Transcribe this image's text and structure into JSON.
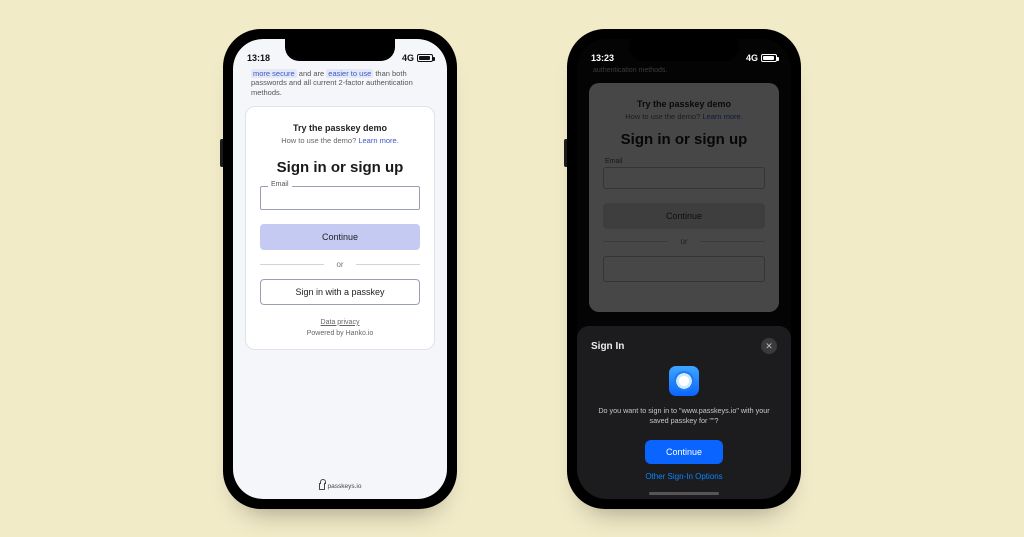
{
  "left": {
    "status": {
      "time": "13:18",
      "network": "4G"
    },
    "intro": {
      "hl1": "more secure",
      "mid1": " and are ",
      "hl2": "easier to use",
      "tail": " than both passwords and all current 2-factor authentication methods."
    },
    "card": {
      "try_title": "Try the passkey demo",
      "howto_prefix": "How to use the demo? ",
      "howto_link": "Learn more.",
      "headline": "Sign in or sign up",
      "email_label": "Email",
      "continue": "Continue",
      "or": "or",
      "passkey_btn": "Sign in with a passkey",
      "privacy": "Data privacy",
      "powered": "Powered by Hanko.io"
    },
    "footer_domain": "passkeys.io"
  },
  "right": {
    "status": {
      "time": "13:23",
      "network": "4G"
    },
    "auth_line": "authentication methods.",
    "bg": {
      "try_title": "Try the passkey demo",
      "howto_prefix": "How to use the demo? ",
      "howto_link": "Learn more.",
      "headline": "Sign in or sign up",
      "email_label": "Email",
      "continue": "Continue",
      "or": "or"
    },
    "sheet": {
      "title": "Sign In",
      "message_pre": "Do you want to sign in to \"www.passkeys.io\" with your saved passkey for \"",
      "message_post": "\"?",
      "continue": "Continue",
      "other": "Other Sign-In Options"
    }
  }
}
